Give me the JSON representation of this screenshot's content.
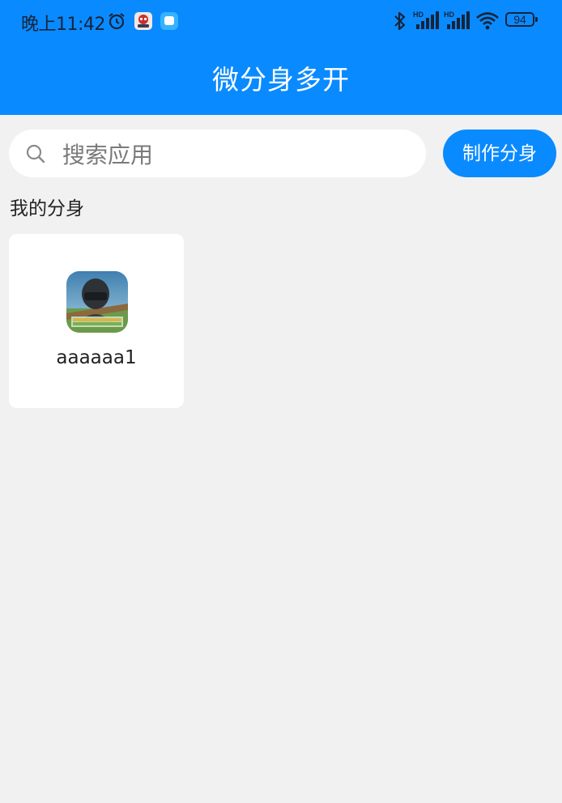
{
  "status_bar": {
    "time": "晚上11:42",
    "battery": "94",
    "signal_label": "HD"
  },
  "header": {
    "title": "微分身多开"
  },
  "search": {
    "placeholder": "搜索应用",
    "value": ""
  },
  "toolbar": {
    "make_clone_label": "制作分身"
  },
  "section": {
    "title": "我的分身"
  },
  "clones": [
    {
      "name": "aaaaaa1",
      "icon": "game-app-icon"
    }
  ],
  "colors": {
    "primary": "#0a8aff",
    "background": "#f1f1f1",
    "card": "#ffffff"
  }
}
